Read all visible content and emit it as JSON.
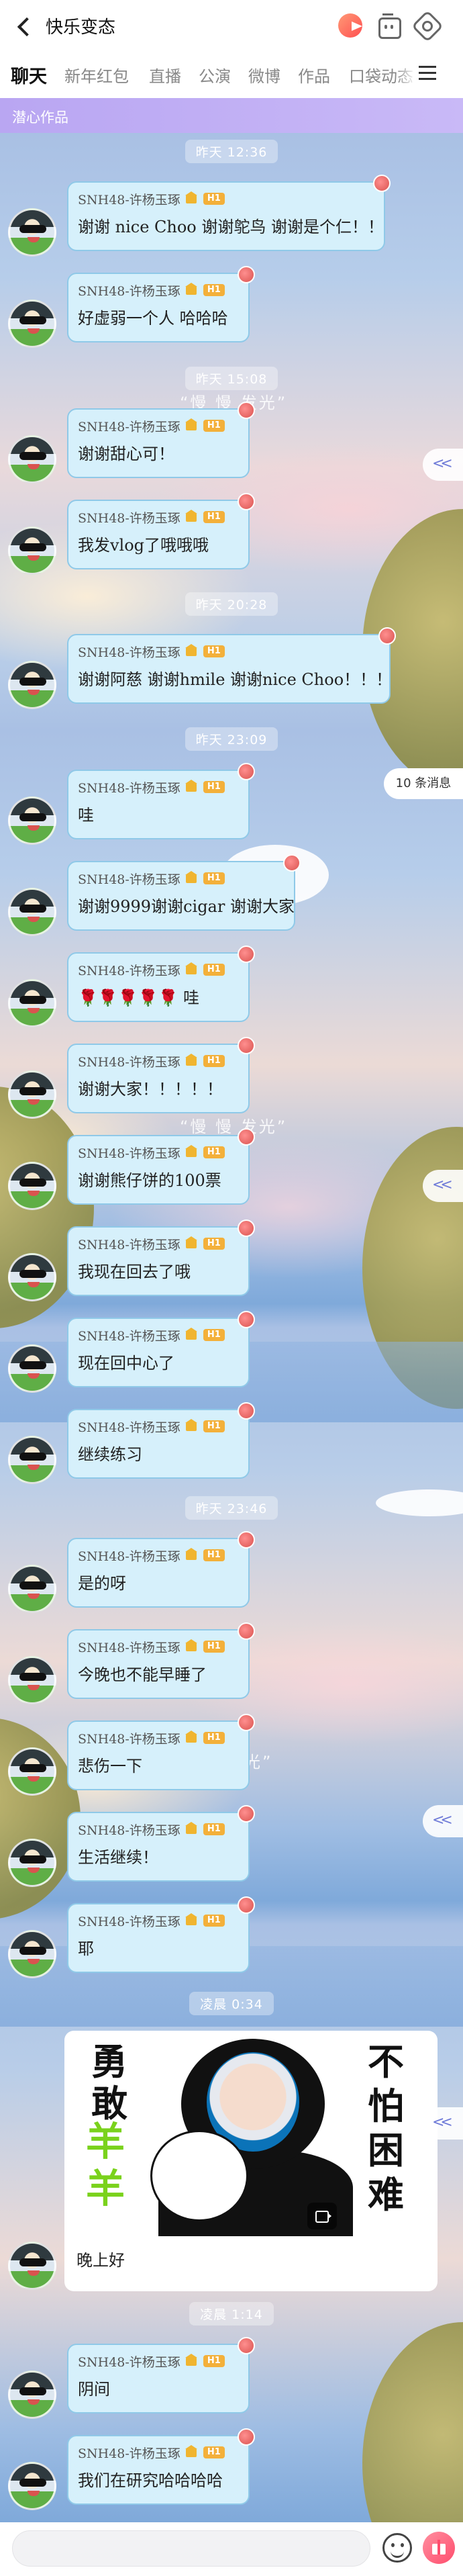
{
  "header": {
    "title": "快乐变态",
    "icons": [
      "back-icon",
      "pacman-game-icon",
      "robot-bag-icon",
      "settings-icon"
    ]
  },
  "tabs": [
    {
      "label": "聊天",
      "active": true
    },
    {
      "label": "新年红包"
    },
    {
      "label": "直播"
    },
    {
      "label": "公演"
    },
    {
      "label": "微博"
    },
    {
      "label": "作品"
    },
    {
      "label": "口袋动态"
    }
  ],
  "group_banner": "潜心作品",
  "sender": "SNH48-许杨玉琢",
  "level_badge": "H1",
  "timestamps": [
    "昨天 12:36",
    "昨天 15:08",
    "昨天 20:28",
    "昨天 23:09",
    "昨天 23:46",
    "凌晨 0:34",
    "凌晨 1:14"
  ],
  "messages": [
    {
      "text": "谢谢 nice Choo 谢谢鸵鸟 谢谢是个仁！！"
    },
    {
      "text": "好虚弱一个人 哈哈哈"
    },
    {
      "text": "谢谢甜心可！"
    },
    {
      "text": "我发vlog了哦哦哦"
    },
    {
      "text": "谢谢阿慈 谢谢hmile 谢谢nice Choo！！！"
    },
    {
      "text": "哇"
    },
    {
      "text": "谢谢9999谢谢cigar 谢谢大家"
    },
    {
      "text": "🌹🌹🌹🌹🌹 哇"
    },
    {
      "text": "谢谢大家！！！！！"
    },
    {
      "text": "谢谢熊仔饼的100票"
    },
    {
      "text": "我现在回去了哦"
    },
    {
      "text": "现在回中心了"
    },
    {
      "text": "继续练习"
    },
    {
      "text": "是的呀"
    },
    {
      "text": "今晚也不能早睡了"
    },
    {
      "text": "悲伤一下"
    },
    {
      "text": "生活继续！"
    },
    {
      "text": "耶"
    },
    {
      "text": "阴间"
    },
    {
      "text": "我们在研究哈哈哈哈"
    }
  ],
  "image_message": {
    "sticker_left": "勇敢",
    "sticker_green": "羊羊",
    "sticker_right": "不怕困难",
    "caption": "晚上好"
  },
  "watermark": "“慢 慢 发光”",
  "watermark_tail": "光”",
  "unread_badge": "10 条消息",
  "side_button": "<<",
  "input": {
    "placeholder": ""
  },
  "colors": {
    "accent": "#b9a6f2",
    "bubble": "#d6f0fb",
    "bubble_border": "#8fc9e8",
    "badge": "#f3b03a"
  }
}
